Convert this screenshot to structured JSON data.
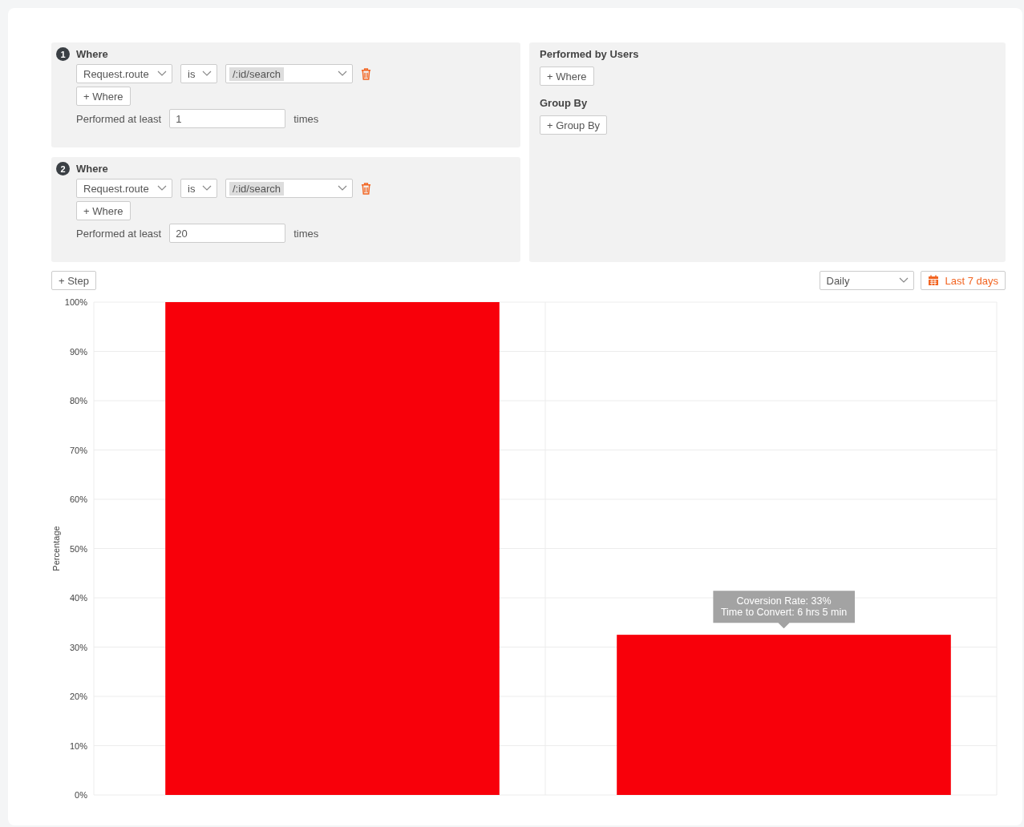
{
  "steps": [
    {
      "number": "1",
      "title": "Where",
      "filters": [
        {
          "property": "Request.route",
          "operator": "is",
          "value": "/:id/search"
        }
      ],
      "add_where": "+ Where",
      "performed_label": "Performed at least",
      "count": "1",
      "times_label": "times"
    },
    {
      "number": "2",
      "title": "Where",
      "filters": [
        {
          "property": "Request.route",
          "operator": "is",
          "value": "/:id/search"
        }
      ],
      "add_where": "+ Where",
      "performed_label": "Performed at least",
      "count": "20",
      "times_label": "times"
    }
  ],
  "users_panel": {
    "title": "Performed by Users",
    "add_where": "+ Where",
    "group_title": "Group By",
    "add_group": "+ Group By"
  },
  "add_step": "+ Step",
  "interval": {
    "value": "Daily"
  },
  "date_range": "Last 7 days",
  "chart": {
    "chart_data": {
      "type": "bar",
      "ylabel": "Percentage",
      "ylim": [
        0,
        100
      ],
      "yticks": [
        {
          "value": 0,
          "label": "0%"
        },
        {
          "value": 10,
          "label": "10%"
        },
        {
          "value": 20,
          "label": "20%"
        },
        {
          "value": 30,
          "label": "30%"
        },
        {
          "value": 40,
          "label": "40%"
        },
        {
          "value": 50,
          "label": "50%"
        },
        {
          "value": 60,
          "label": "60%"
        },
        {
          "value": 70,
          "label": "70%"
        },
        {
          "value": 80,
          "label": "80%"
        },
        {
          "value": 90,
          "label": "90%"
        },
        {
          "value": 100,
          "label": "100%"
        }
      ],
      "grid": true,
      "series": [
        {
          "color": "#f8000a",
          "values": [
            100,
            32.5
          ]
        }
      ],
      "annotations": [
        {
          "text": "Coversion Rate: 33%"
        },
        {
          "text": "Time to Convert: 6 hrs 5 min"
        }
      ]
    }
  }
}
